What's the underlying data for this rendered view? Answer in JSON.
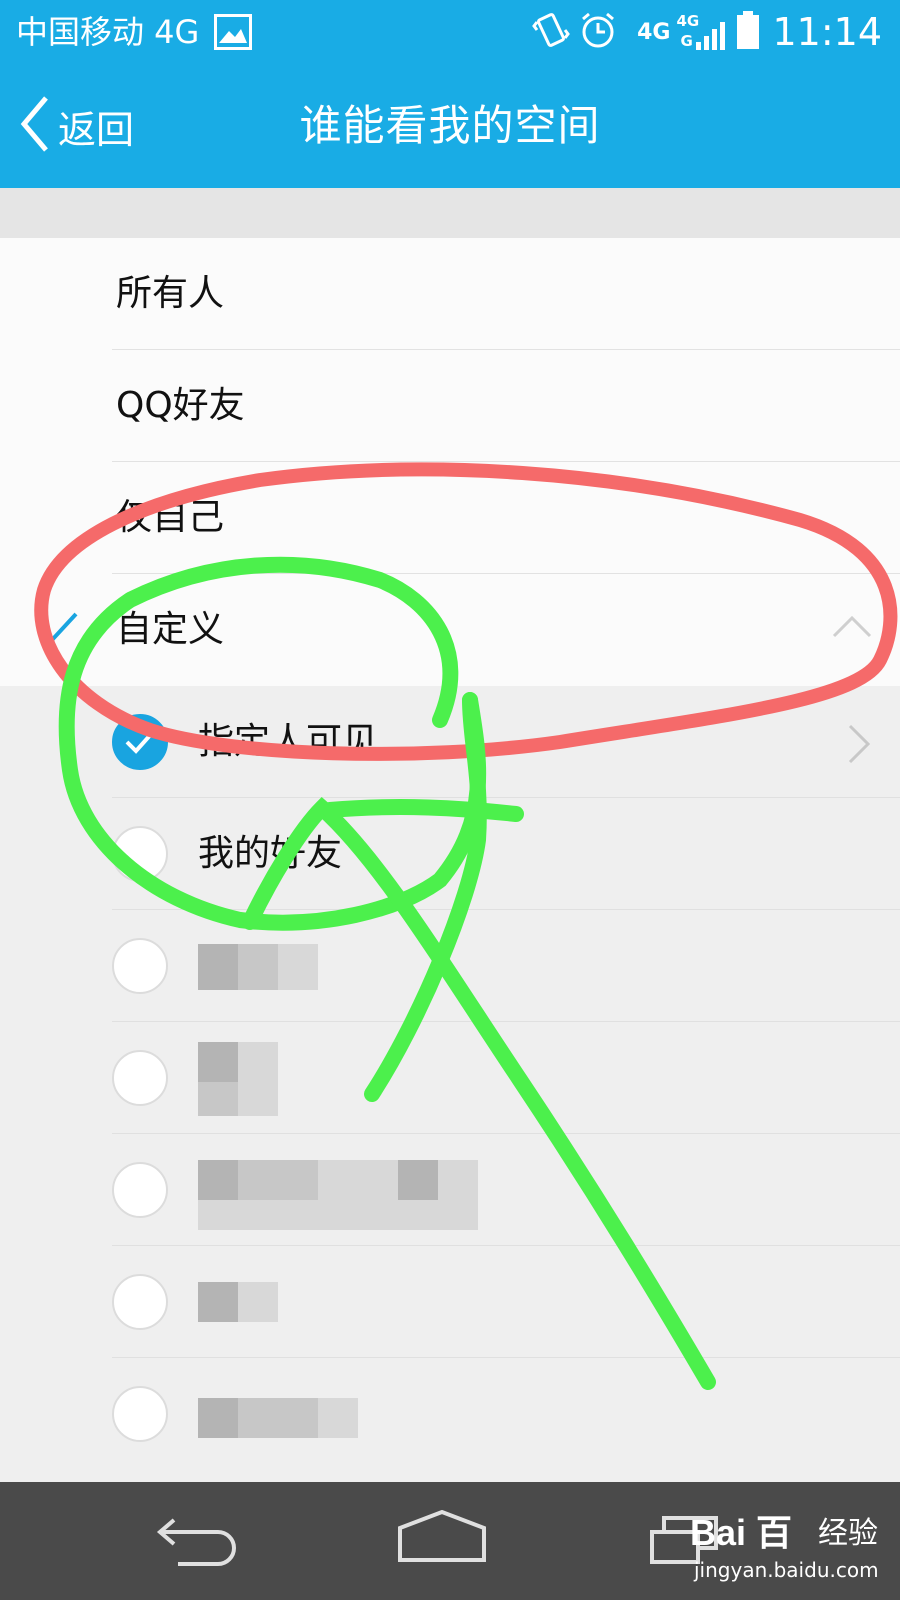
{
  "status_bar": {
    "carrier": "中国移动 4G",
    "net1": "4G",
    "net2": "4G",
    "net2_sub": "G",
    "time": "11:14",
    "icons": [
      "image-icon",
      "vibrate-icon",
      "alarm-icon",
      "signal-icon",
      "battery-icon"
    ]
  },
  "nav": {
    "back_label": "返回",
    "title": "谁能看我的空间"
  },
  "options": [
    {
      "label": "所有人",
      "selected": false
    },
    {
      "label": "QQ好友",
      "selected": false
    },
    {
      "label": "仅自己",
      "selected": false
    },
    {
      "label": "自定义",
      "selected": true,
      "expanded": true
    }
  ],
  "custom_options": [
    {
      "label": "指定人可见",
      "checked": true
    },
    {
      "label": "我的好友",
      "checked": false
    },
    {
      "label": "",
      "checked": false
    },
    {
      "label": "",
      "checked": false
    },
    {
      "label": "",
      "checked": false
    },
    {
      "label": "",
      "checked": false
    },
    {
      "label": "",
      "checked": false
    }
  ],
  "watermark": {
    "logo": "Bai 百",
    "brand": "经验",
    "url": "jingyan.baidu.com"
  },
  "colors": {
    "accent": "#19ace5",
    "annotation_red": "#f56a6a",
    "annotation_green": "#4cf04c"
  }
}
